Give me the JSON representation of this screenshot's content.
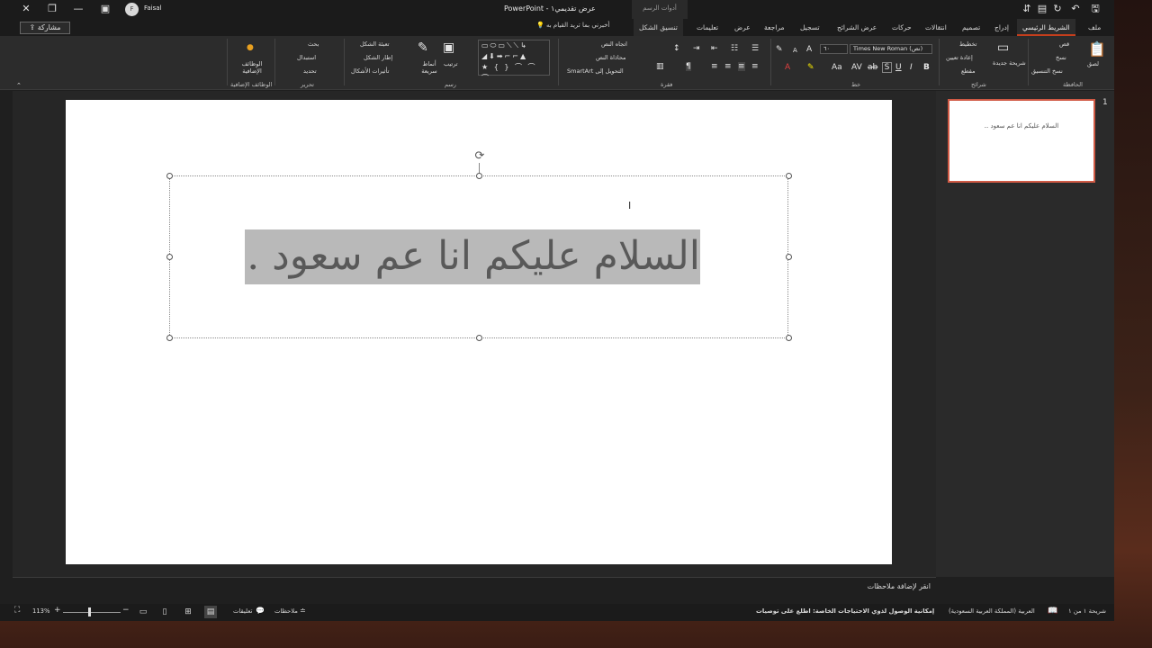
{
  "app": {
    "doc_title": "عرض تقديمي١ - PowerPoint",
    "contextual_group": "أدوات الرسم",
    "user_name": "Faisal",
    "user_initial": "F",
    "share_label": "مشاركة",
    "tellme_placeholder": "أخبرني بما تريد القيام به"
  },
  "tabs": [
    {
      "label": "ملف"
    },
    {
      "label": "الشريط الرئيسي",
      "active": true
    },
    {
      "label": "إدراج"
    },
    {
      "label": "تصميم"
    },
    {
      "label": "انتقالات"
    },
    {
      "label": "حركات"
    },
    {
      "label": "عرض الشرائح"
    },
    {
      "label": "تسجيل"
    },
    {
      "label": "مراجعة"
    },
    {
      "label": "عرض"
    },
    {
      "label": "تعليمات"
    },
    {
      "label": "تنسيق الشكل"
    }
  ],
  "ribbon": {
    "clipboard": {
      "label": "الحافظة",
      "paste": "لصق",
      "cut": "قص",
      "copy": "نسخ",
      "format_painter": "نسخ التنسيق"
    },
    "slides": {
      "label": "شرائح",
      "new_slide": "شريحة جديدة",
      "layout": "تخطيط",
      "reset": "إعادة تعيين",
      "section": "مقطع"
    },
    "font": {
      "label": "خط",
      "font_name": "Times New Roman (نص)",
      "font_size": "٦٠"
    },
    "paragraph": {
      "label": "فقرة",
      "text_direction": "اتجاه النص",
      "align_text": "محاذاة النص",
      "smartart": "التحويل إلى SmartArt"
    },
    "drawing": {
      "label": "رسم",
      "arrange": "ترتيب",
      "quick_styles": "أنماط سريعة",
      "shape_fill": "تعبئة الشكل",
      "shape_outline": "إطار الشكل",
      "shape_effects": "تأثيرات الأشكال"
    },
    "editing": {
      "label": "تحرير",
      "find": "بحث",
      "replace": "استبدال",
      "select": "تحديد"
    },
    "addins": {
      "label": "الوظائف الإضافية",
      "button": "الوظائف الإضافية"
    }
  },
  "slide": {
    "main_text": "السلام عليكم انا عم سعود ..",
    "thumb_number": "1",
    "thumb_text": "السلام عليكم انا عم سعود .."
  },
  "notes": {
    "placeholder": "انقر لإضافة ملاحظات"
  },
  "status": {
    "slide_counter": "شريحة ١ من ١",
    "language": "العربية (المملكة العربية السعودية)",
    "accessibility": "إمكانية الوصول لذوي الاحتياجات الخاصة: اطلع على توصيات",
    "notes_btn": "ملاحظات",
    "comments_btn": "تعليقات",
    "zoom": "113%"
  },
  "colors": {
    "accent": "#c43e1c",
    "thumb_border": "#d05a45",
    "text_highlight": "#b9b9b9"
  }
}
